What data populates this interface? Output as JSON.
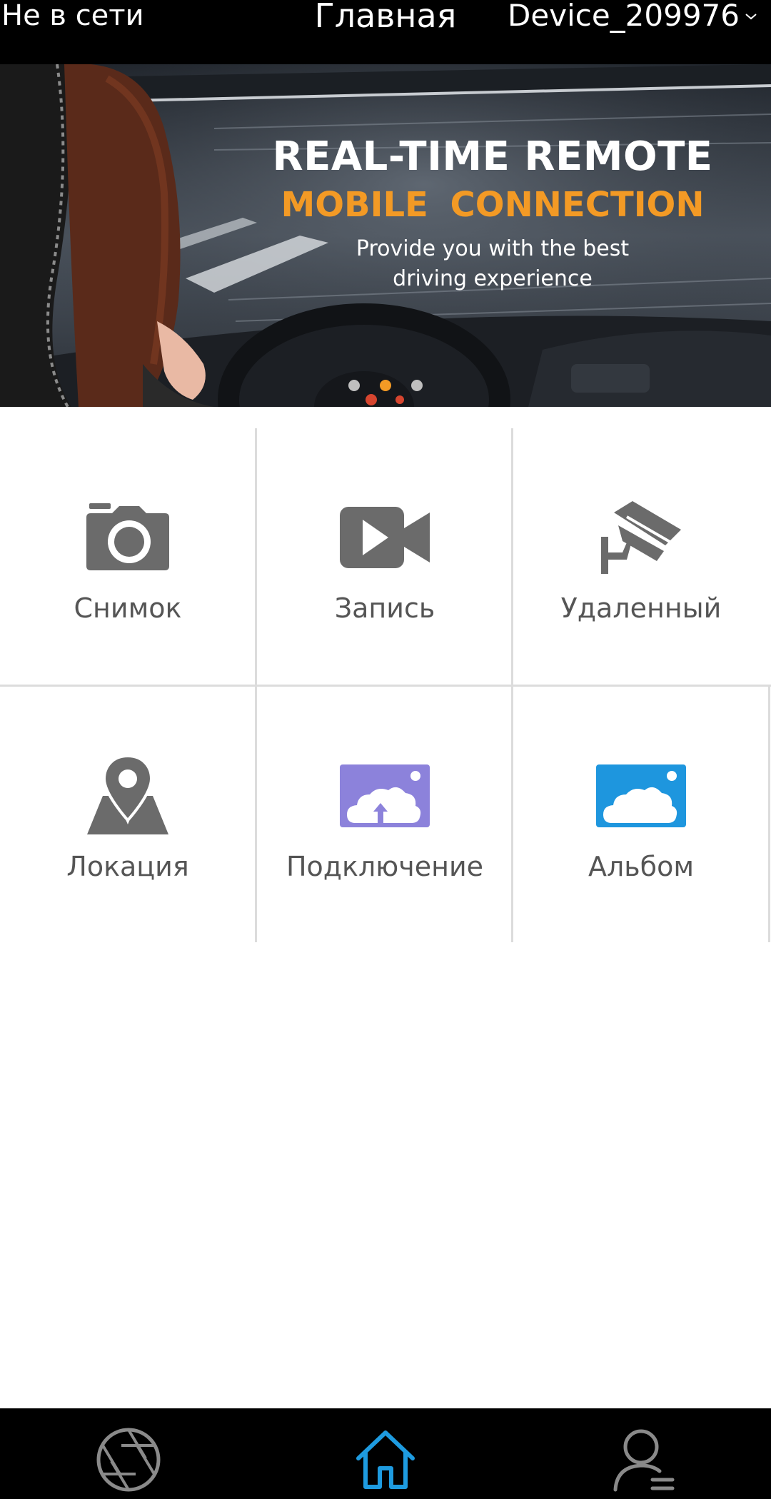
{
  "topbar": {
    "status_text": "Не в сети",
    "title": "Главная",
    "device_name": "Device_209976"
  },
  "banner": {
    "headline": "REAL-TIME REMOTE",
    "subheadline": "MOBILE  CONNECTION",
    "tagline_line1": "Provide you with the best",
    "tagline_line2": "driving experience",
    "active_slide": 2,
    "slide_count": 3
  },
  "grid": {
    "items": [
      {
        "label": "Снимок",
        "icon": "camera-icon"
      },
      {
        "label": "Запись",
        "icon": "video-camera-icon"
      },
      {
        "label": "Удаленный",
        "icon": "cctv-icon"
      },
      {
        "label": "Локация",
        "icon": "location-map-icon"
      },
      {
        "label": "Подключение",
        "icon": "cloud-upload-icon"
      },
      {
        "label": "Альбом",
        "icon": "cloud-album-icon"
      }
    ]
  },
  "bottom_nav": {
    "items": [
      {
        "icon": "aperture-icon",
        "active": false
      },
      {
        "icon": "home-icon",
        "active": true
      },
      {
        "icon": "user-icon",
        "active": false
      }
    ]
  },
  "colors": {
    "accent_orange": "#f39a25",
    "active_nav_blue": "#1e9be0",
    "upload_purple": "#8c82db",
    "album_blue": "#1e96de",
    "icon_gray": "#6b6b6b"
  }
}
